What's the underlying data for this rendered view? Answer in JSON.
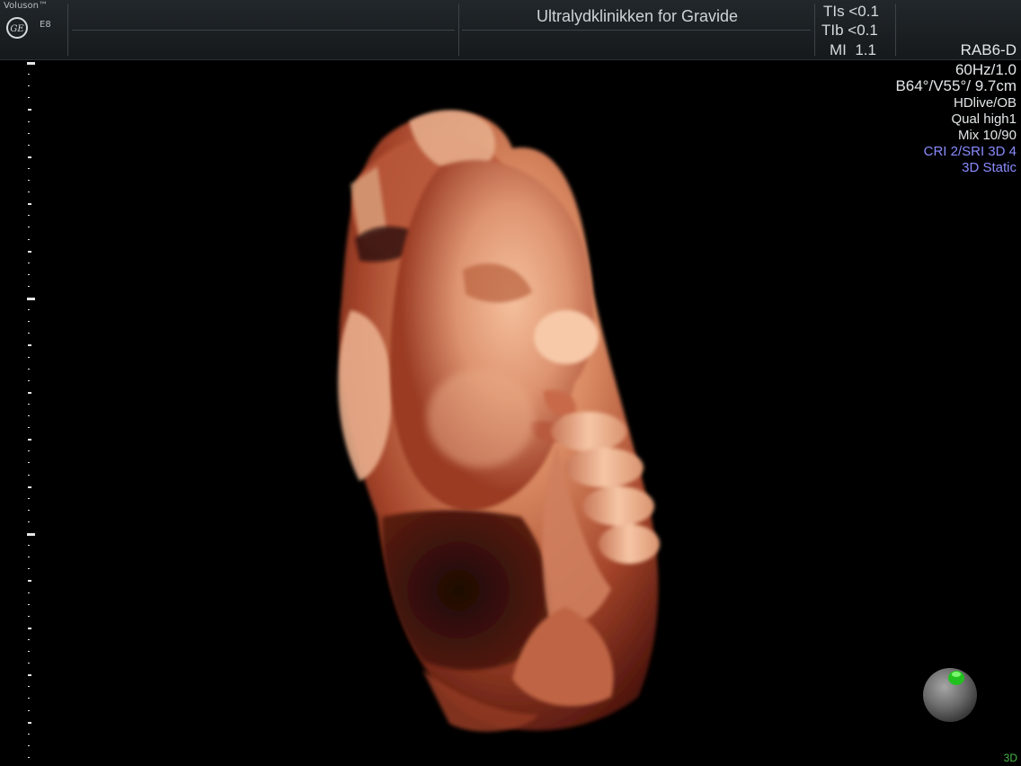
{
  "header": {
    "brand": "Voluson™",
    "model": "E8",
    "logo_text": "GE",
    "clinic_title": "Ultralydklinikken for Gravide",
    "safety": [
      {
        "label": "TIs",
        "value": "<0.1"
      },
      {
        "label": "TIb",
        "value": "<0.1"
      },
      {
        "label": "MI",
        "value": "1.1"
      }
    ]
  },
  "info_panel": {
    "probe": "RAB6-D",
    "frame_rate": "60Hz/1.0",
    "geometry": "B64°/V55°/ 9.7cm",
    "preset": "HDlive/OB",
    "quality": "Qual high1",
    "mix": "Mix 10/90",
    "cri_sri": "CRI 2/SRI 3D 4",
    "mode": "3D Static"
  },
  "corner_mode": "3D",
  "colors": {
    "header_bg": "#1b2023",
    "mode_text_blue": "#8a8cff",
    "orientation_marker": "#21c21f",
    "corner_mode_green": "#49b84a",
    "skin_tone": "#d98a62"
  },
  "icons": {
    "logo": "ge-logo-icon",
    "orientation": "orientation-ball-icon"
  }
}
